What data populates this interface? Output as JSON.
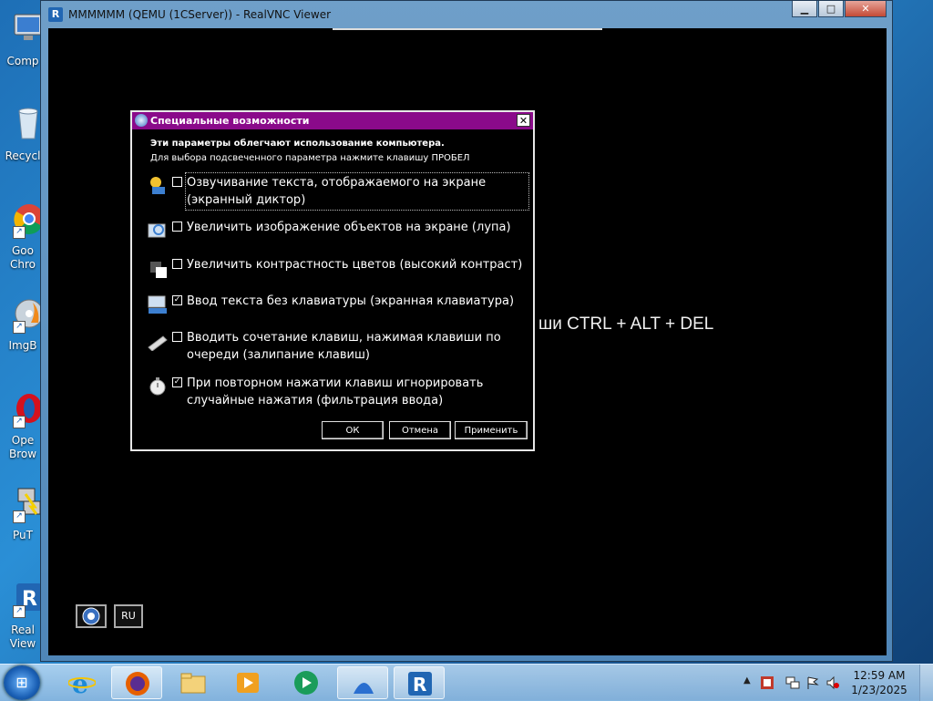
{
  "desktop": {
    "icons": [
      {
        "label": "Comp",
        "icon": "computer-icon"
      },
      {
        "label": "Recycl",
        "icon": "recycle-bin-icon"
      },
      {
        "label": "Goo Chro",
        "icon": "chrome-icon"
      },
      {
        "label": "ImgB",
        "icon": "imgburn-icon"
      },
      {
        "label": "Ope Brow",
        "icon": "opera-icon"
      },
      {
        "label": "PuT",
        "icon": "putty-icon"
      },
      {
        "label": "Real View",
        "icon": "realvnc-icon"
      }
    ]
  },
  "vnc_window": {
    "title": "MMMMMM (QEMU (1CServer)) - RealVNC Viewer",
    "buttons": {
      "minimize": "▁",
      "maximize": "□",
      "close": "✕"
    }
  },
  "remote": {
    "login_hint": "ши CTRL + ALT + DEL",
    "tray": {
      "lang": "RU"
    }
  },
  "dialog": {
    "title": "Специальные возможности",
    "close": "✕",
    "intro": "Эти параметры облегчают использование компьютера.",
    "hint": "Для выбора подсвеченного параметра нажмите клавишу ПРОБЕЛ",
    "options": [
      {
        "label": "Озвучивание текста, отображаемого на экране (экранный диктор)",
        "checked": false,
        "mark": "",
        "icon": "narrator-icon"
      },
      {
        "label": "Увеличить изображение объектов на экране (лупа)",
        "checked": false,
        "mark": "",
        "icon": "magnifier-icon"
      },
      {
        "label": "Увеличить контрастность цветов (высокий контраст)",
        "checked": false,
        "mark": "",
        "icon": "high-contrast-icon"
      },
      {
        "label": "Ввод текста без клавиатуры (экранная клавиатура)",
        "checked": true,
        "mark": "✓",
        "icon": "on-screen-keyboard-icon"
      },
      {
        "label": "Вводить сочетание клавиш, нажимая клавиши по очереди (залипание клавиш)",
        "checked": false,
        "mark": "",
        "icon": "sticky-keys-icon"
      },
      {
        "label": "При повторном нажатии клавиш игнорировать случайные нажатия (фильтрация ввода)",
        "checked": true,
        "mark": "✓",
        "icon": "filter-keys-icon"
      }
    ],
    "buttons": {
      "ok": "ОК",
      "cancel": "Отмена",
      "apply": "Применить"
    }
  },
  "taskbar": {
    "apps": [
      {
        "name": "internet-explorer",
        "active": false
      },
      {
        "name": "firefox",
        "active": true
      },
      {
        "name": "file-explorer",
        "active": false
      },
      {
        "name": "media-player",
        "active": false
      },
      {
        "name": "media-app",
        "active": false
      },
      {
        "name": "shark-app",
        "active": true
      },
      {
        "name": "realvnc",
        "active": true
      }
    ],
    "clock": {
      "time": "12:59 AM",
      "date": "1/23/2025"
    }
  }
}
